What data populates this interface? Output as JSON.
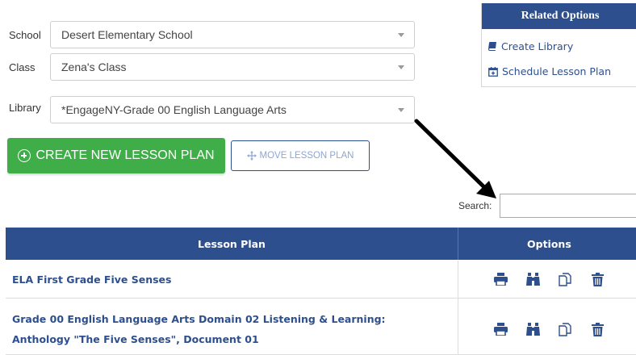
{
  "filters": {
    "school": {
      "label": "School",
      "value": "Desert Elementary School"
    },
    "class": {
      "label": "Class",
      "value": "Zena's Class"
    },
    "library": {
      "label": "Library",
      "value": "*EngageNY-Grade 00 English Language Arts"
    }
  },
  "buttons": {
    "create_lesson_plan": "CREATE NEW LESSON PLAN",
    "move_lesson_plan": "MOVE LESSON PLAN"
  },
  "related_options": {
    "title": "Related Options",
    "links": [
      {
        "label": "Create Library",
        "icon": "book-icon"
      },
      {
        "label": "Schedule Lesson Plan",
        "icon": "calendar-plus-icon"
      }
    ]
  },
  "search": {
    "label": "Search:",
    "value": ""
  },
  "table": {
    "headers": {
      "lesson_plan": "Lesson Plan",
      "options": "Options"
    },
    "rows": [
      {
        "title_lines": [
          "ELA First Grade Five Senses"
        ]
      },
      {
        "title_lines": [
          "Grade 00 English Language Arts Domain 02 Listening & Learning:",
          "Anthology \"The Five Senses\", Document 01"
        ]
      }
    ],
    "option_icons": [
      "print-icon",
      "preview-binoculars-icon",
      "copy-icon",
      "delete-trash-icon"
    ]
  },
  "colors": {
    "primary": "#2d4f8e",
    "success": "#3fae49",
    "annotation_arrow": "#000000"
  }
}
